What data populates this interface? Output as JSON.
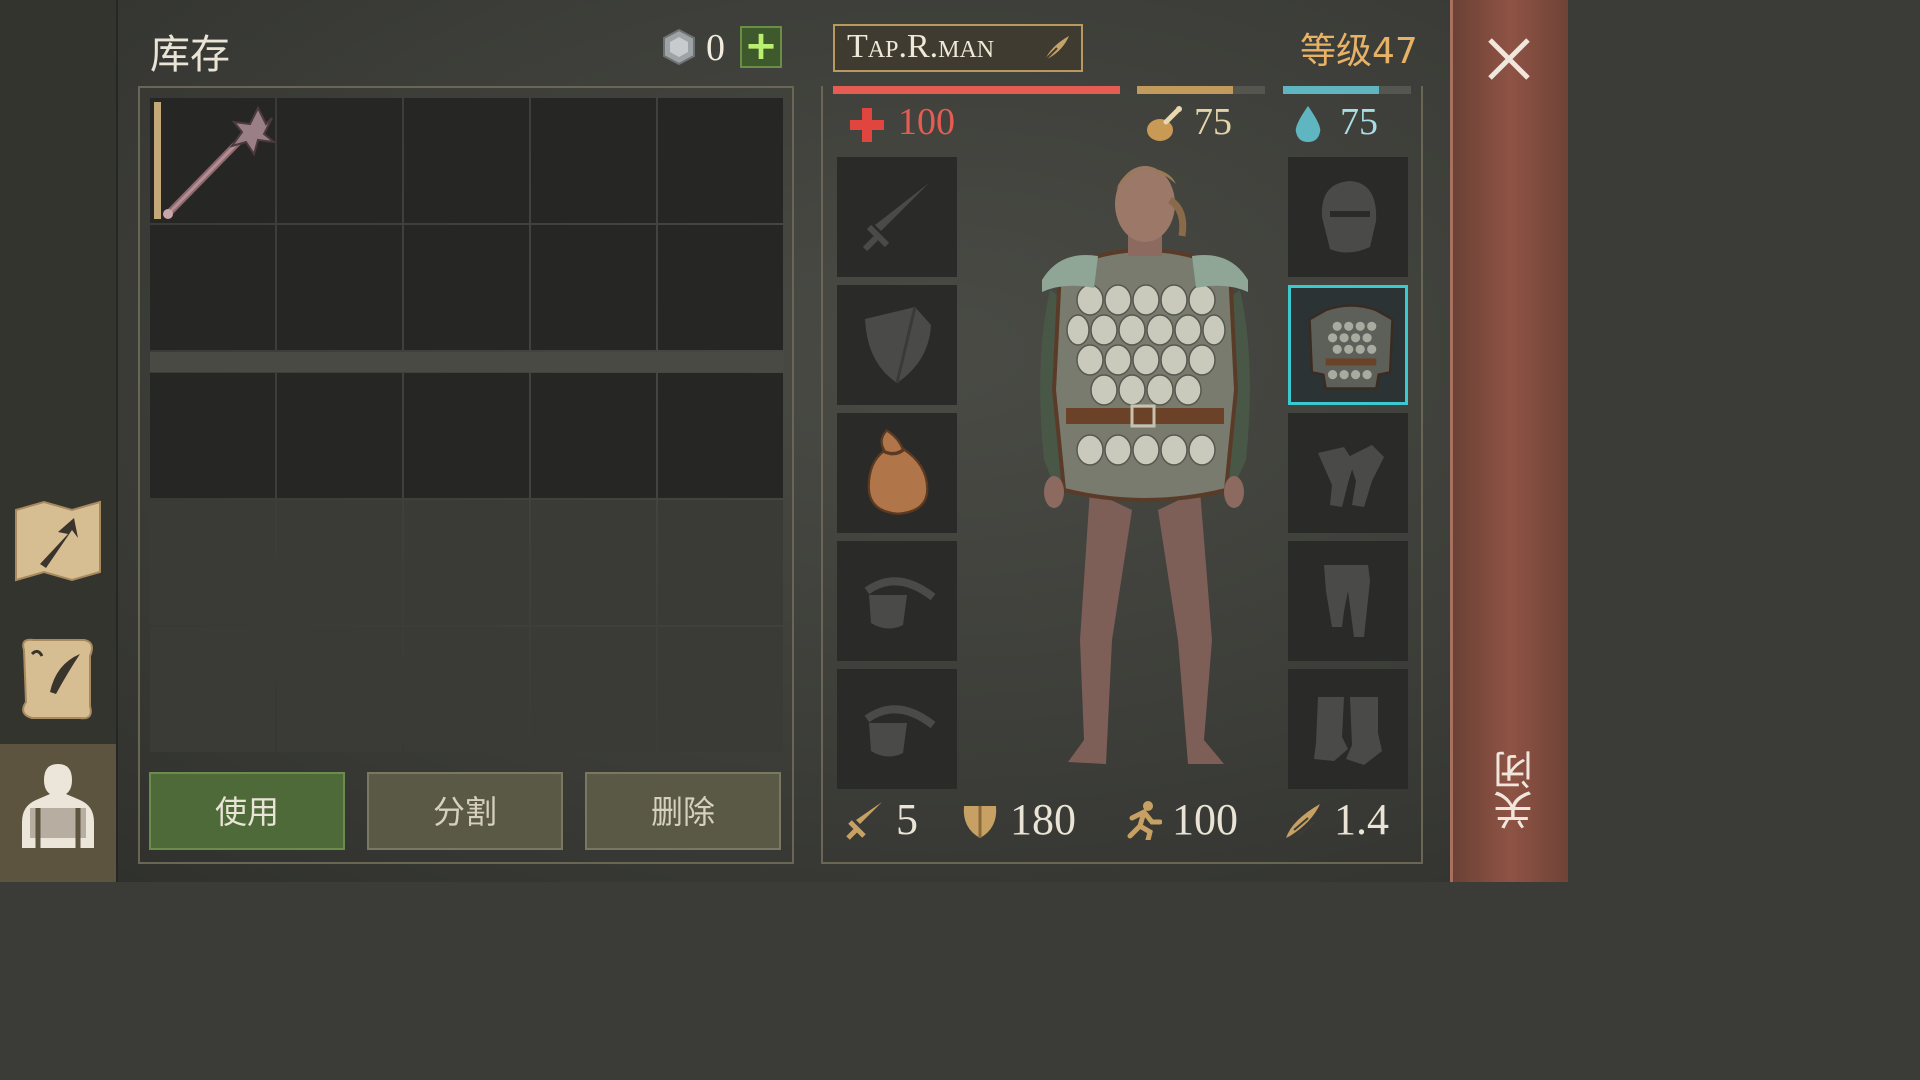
{
  "inventory": {
    "title": "库存",
    "currency": "0",
    "add_label": "+",
    "actions": {
      "use": "使用",
      "split": "分割",
      "delete": "删除"
    },
    "item": "mace-icon"
  },
  "character": {
    "name": "Tap.R.man",
    "level": "等级47",
    "health": "100",
    "food": "75",
    "water": "75",
    "bars": {
      "health": 1.0,
      "food": 0.75,
      "water": 0.75
    },
    "stats": {
      "attack": "5",
      "armor": "180",
      "speed": "100",
      "weight": "1.4"
    }
  },
  "colors": {
    "health": "#e45c52",
    "food": "#c29a5c",
    "water": "#5fb6c0",
    "use_button": "#4e6a39",
    "close_bar": "#8e5344"
  },
  "close": {
    "label": "关闭"
  },
  "slots": {
    "left": [
      "sword-icon",
      "shield-icon",
      "bag-icon",
      "ring-icon",
      "ring-icon"
    ],
    "right": [
      "helmet-icon",
      "chest-armor-icon",
      "gloves-icon",
      "pants-icon",
      "boots-icon"
    ]
  }
}
